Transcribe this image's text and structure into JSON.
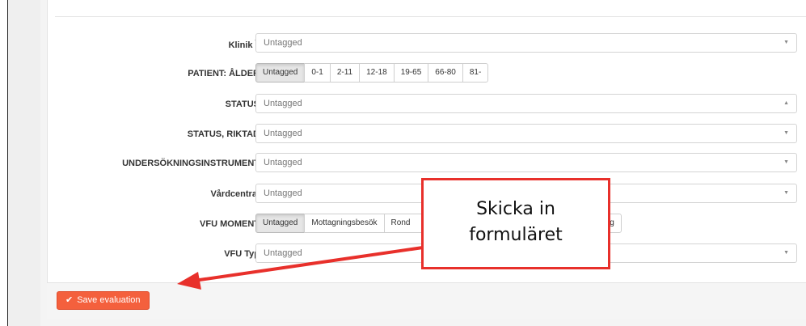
{
  "form": {
    "rows": [
      {
        "label": "Klinik",
        "required_mark": "*",
        "type": "select",
        "value": "Untagged"
      },
      {
        "label": "PATIENT: ÅLDER",
        "type": "buttons",
        "options": [
          "Untagged",
          "0-1",
          "2-11",
          "12-18",
          "19-65",
          "66-80",
          "81-"
        ],
        "active": 0
      },
      {
        "label": "STATUS",
        "type": "select",
        "value": "Untagged",
        "caret": "▲"
      },
      {
        "label": "STATUS, RIKTAD",
        "type": "select",
        "value": "Untagged"
      },
      {
        "label": "UNDERSÖKNINGSINSTRUMENT",
        "type": "select",
        "value": "Untagged"
      },
      {
        "label": "Vårdcentral",
        "type": "select",
        "value": "Untagged"
      },
      {
        "label": "VFU MOMENT",
        "type": "buttons",
        "options": [
          "Untagged",
          "Mottagningsbesök",
          "Rond",
          "",
          "vdelning"
        ],
        "active": 0
      },
      {
        "label": "VFU Typ",
        "type": "select",
        "value": "Untagged"
      }
    ],
    "caret_down": "▼"
  },
  "footer": {
    "save_label": "Save evaluation",
    "save_icon": "check-icon"
  },
  "annotation": {
    "line1": "Skicka in",
    "line2": "formuläret",
    "border_color": "#e8302b"
  },
  "colors": {
    "save_button": "#f4603d",
    "arrow": "#e8302b"
  }
}
